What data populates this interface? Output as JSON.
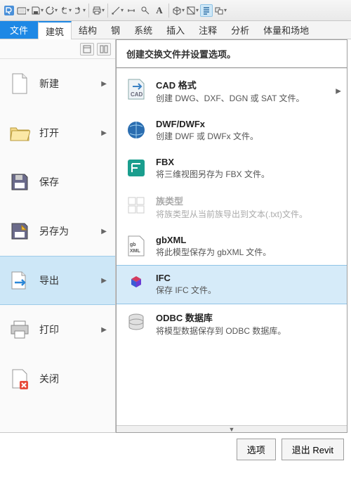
{
  "ribbon_tabs": {
    "file": "文件",
    "arch": "建筑",
    "struct": "结构",
    "steel": "钢",
    "system": "系统",
    "insert": "插入",
    "annotate": "注释",
    "analyze": "分析",
    "mass": "体量和场地"
  },
  "sidebar": {
    "new": "新建",
    "open": "打开",
    "save": "保存",
    "saveas": "另存为",
    "export": "导出",
    "print": "打印",
    "close": "关闭"
  },
  "submenu": {
    "title": "创建交换文件并设置选项。",
    "cad": {
      "title": "CAD 格式",
      "desc": "创建 DWG、DXF、DGN 或 SAT 文件。"
    },
    "dwf": {
      "title": "DWF/DWFx",
      "desc": "创建 DWF 或 DWFx 文件。"
    },
    "fbx": {
      "title": "FBX",
      "desc": "将三维视图另存为 FBX 文件。"
    },
    "famtype": {
      "title": "族类型",
      "desc": "将族类型从当前族导出到文本(.txt)文件。"
    },
    "gbxml": {
      "title": "gbXML",
      "desc": "将此模型保存为 gbXML 文件。"
    },
    "ifc": {
      "title": "IFC",
      "desc": "保存 IFC 文件。"
    },
    "odbc": {
      "title": "ODBC 数据库",
      "desc": "将模型数据保存到 ODBC 数据库。"
    }
  },
  "footer": {
    "options": "选项",
    "exit": "退出 Revit"
  }
}
